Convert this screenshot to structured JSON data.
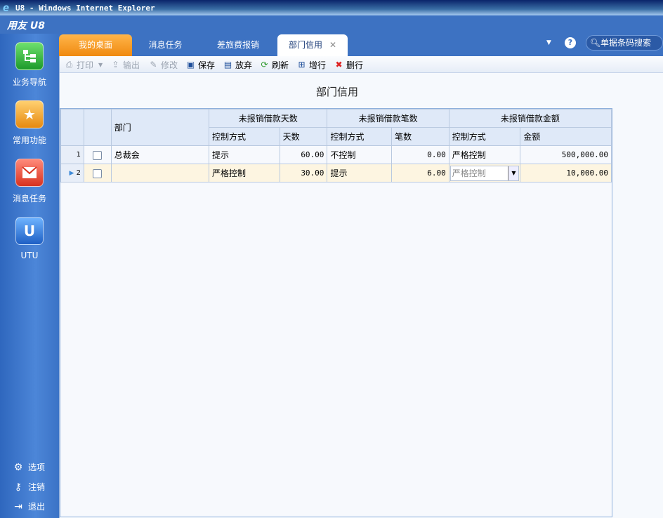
{
  "window": {
    "title": "U8 - Windows Internet Explorer"
  },
  "app": {
    "brand": "用友 U8"
  },
  "leftnav": {
    "items": [
      {
        "label": "业务导航",
        "icon": "folder-tree-icon"
      },
      {
        "label": "常用功能",
        "icon": "star-folder-icon"
      },
      {
        "label": "消息任务",
        "icon": "mail-icon"
      },
      {
        "label": "UTU",
        "icon": "utu-icon"
      }
    ],
    "bottom": [
      {
        "label": "选项",
        "icon": "gear-icon"
      },
      {
        "label": "注销",
        "icon": "key-icon"
      },
      {
        "label": "退出",
        "icon": "exit-icon"
      }
    ]
  },
  "tabs": [
    {
      "label": "我的桌面"
    },
    {
      "label": "消息任务"
    },
    {
      "label": "差旅费报销"
    },
    {
      "label": "部门信用"
    }
  ],
  "header": {
    "search_placeholder": "单据条码搜索"
  },
  "toolbar": {
    "print": "打印",
    "output": "输出",
    "edit": "修改",
    "save": "保存",
    "discard": "放弃",
    "refresh": "刷新",
    "add_row": "增行",
    "delete_row": "删行"
  },
  "page": {
    "title": "部门信用"
  },
  "grid": {
    "col_dept": "部门",
    "group_days": "未报销借款天数",
    "group_count": "未报销借款笔数",
    "group_amount": "未报销借款金额",
    "sub_mode": "控制方式",
    "sub_days": "天数",
    "sub_count": "笔数",
    "sub_amount": "金额",
    "rows": [
      {
        "num": "1",
        "dept": "总裁会",
        "days_mode": "提示",
        "days": "60.00",
        "count_mode": "不控制",
        "count": "0.00",
        "amount_mode": "严格控制",
        "amount": "500,000.00"
      },
      {
        "num": "2",
        "dept": "",
        "days_mode": "严格控制",
        "days": "30.00",
        "count_mode": "提示",
        "count": "6.00",
        "amount_mode": "严格控制",
        "amount": "10,000.00"
      }
    ]
  }
}
